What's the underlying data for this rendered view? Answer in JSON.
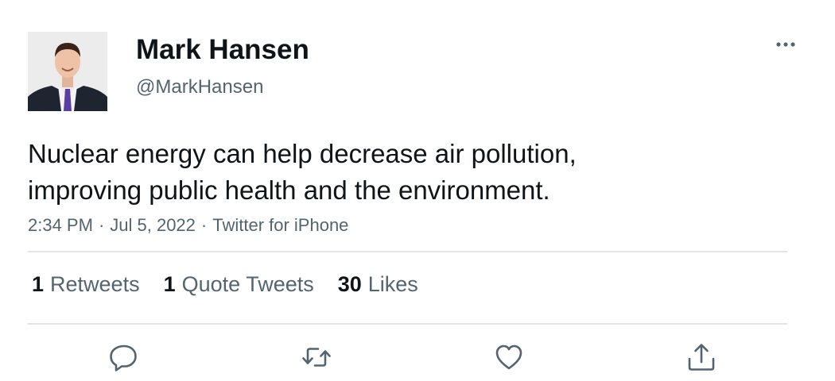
{
  "author": {
    "display_name": "Mark Hansen",
    "handle": "@MarkHansen"
  },
  "tweet": {
    "text_lines": [
      "Nuclear energy can help decrease air pollution,",
      "improving public health and the environment."
    ],
    "time": "2:34 PM",
    "date": "Jul 5, 2022",
    "source": "Twitter for iPhone",
    "separator": "·"
  },
  "stats": {
    "retweets": {
      "count": "1",
      "label": "Retweets"
    },
    "quote_tweets": {
      "count": "1",
      "label": "Quote Tweets"
    },
    "likes": {
      "count": "30",
      "label": "Likes"
    }
  },
  "icons": {
    "more": "more-horizontal-icon",
    "reply": "reply-icon",
    "retweet": "retweet-icon",
    "like": "heart-icon",
    "share": "share-icon"
  },
  "colors": {
    "text_primary": "#0f1419",
    "text_secondary": "#536471",
    "divider": "#e1e5e8"
  }
}
